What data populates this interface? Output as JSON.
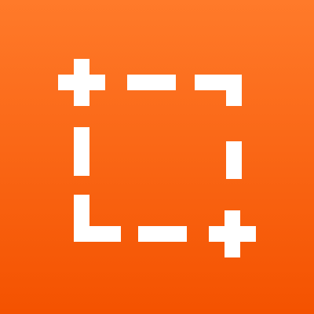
{
  "app_icon": {
    "icon": "screenshot-crop-selection-icon",
    "colors": {
      "gradient_top": "#FF7A2A",
      "gradient_bottom": "#F45200",
      "glyph": "#FFFFFF"
    }
  }
}
